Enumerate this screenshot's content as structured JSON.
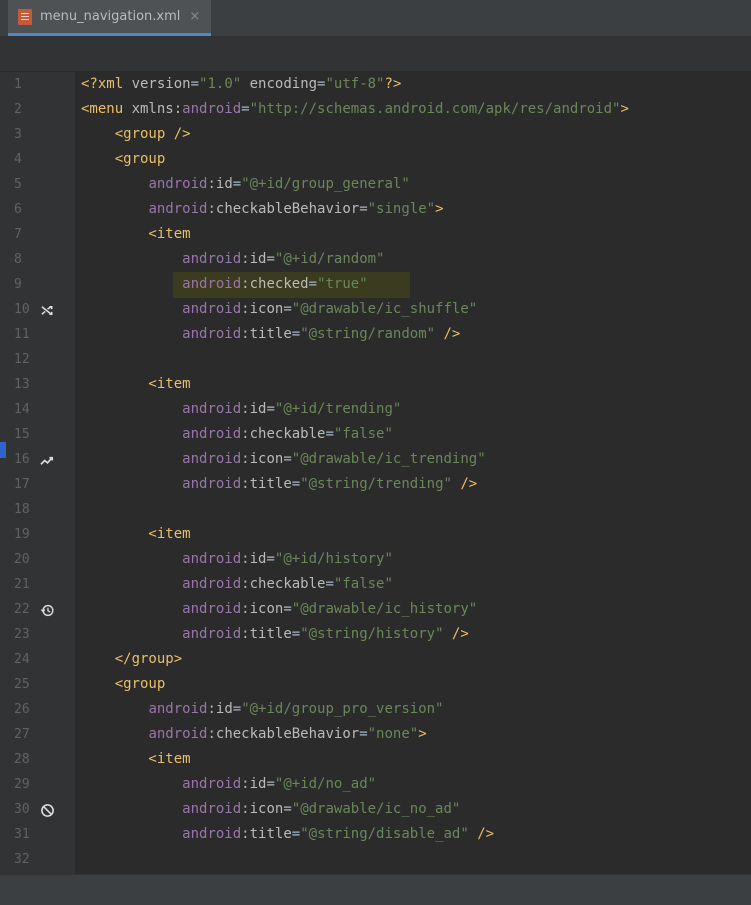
{
  "tab": {
    "filename": "menu_navigation.xml",
    "close_glyph": "×",
    "file_icon": "xml-file-icon"
  },
  "gutter": {
    "line_numbers": [
      "1",
      "2",
      "3",
      "4",
      "5",
      "6",
      "7",
      "8",
      "9",
      "10",
      "11",
      "12",
      "13",
      "14",
      "15",
      "16",
      "17",
      "18",
      "19",
      "20",
      "21",
      "22",
      "23",
      "24",
      "25",
      "26",
      "27",
      "28",
      "29",
      "30",
      "31",
      "32"
    ],
    "icons": [
      {
        "line": 10,
        "icon": "shuffle-icon"
      },
      {
        "line": 16,
        "icon": "trending-icon"
      },
      {
        "line": 22,
        "icon": "history-icon"
      },
      {
        "line": 30,
        "icon": "no-ad-icon"
      }
    ]
  },
  "highlight_line": 9,
  "colors": {
    "tag": "#e8bf6a",
    "namespace": "#9876aa",
    "attribute": "#bababa",
    "value": "#6a8759",
    "plain": "#a9b7c6",
    "line_number": "#606366",
    "highlight": "#3b3b20",
    "tab_underline": "#4a88c7"
  },
  "code": [
    [
      [
        "t",
        "<?xml "
      ],
      [
        "a",
        "version"
      ],
      [
        "p",
        "="
      ],
      [
        "v",
        "\"1.0\""
      ],
      [
        "a",
        " encoding"
      ],
      [
        "p",
        "="
      ],
      [
        "v",
        "\"utf-8\""
      ],
      [
        "t",
        "?>"
      ]
    ],
    [
      [
        "t",
        "<menu "
      ],
      [
        "a",
        "xmlns:"
      ],
      [
        "n",
        "android"
      ],
      [
        "p",
        "="
      ],
      [
        "v",
        "\"http://schemas.android.com/apk/res/android\""
      ],
      [
        "t",
        ">"
      ]
    ],
    [
      [
        "t",
        "    <group />"
      ]
    ],
    [
      [
        "t",
        "    <group"
      ]
    ],
    [
      [
        "p",
        "        "
      ],
      [
        "n",
        "android"
      ],
      [
        "p",
        ":"
      ],
      [
        "a",
        "id"
      ],
      [
        "p",
        "="
      ],
      [
        "v",
        "\"@+id/group_general\""
      ]
    ],
    [
      [
        "p",
        "        "
      ],
      [
        "n",
        "android"
      ],
      [
        "p",
        ":"
      ],
      [
        "a",
        "checkableBehavior"
      ],
      [
        "p",
        "="
      ],
      [
        "v",
        "\"single\""
      ],
      [
        "t",
        ">"
      ]
    ],
    [
      [
        "t",
        "        <item"
      ]
    ],
    [
      [
        "p",
        "            "
      ],
      [
        "n",
        "android"
      ],
      [
        "p",
        ":"
      ],
      [
        "a",
        "id"
      ],
      [
        "p",
        "="
      ],
      [
        "v",
        "\"@+id/random\""
      ]
    ],
    [
      [
        "p",
        "            "
      ],
      [
        "n",
        "android"
      ],
      [
        "p",
        ":"
      ],
      [
        "a",
        "checked"
      ],
      [
        "p",
        "="
      ],
      [
        "v",
        "\"true\""
      ]
    ],
    [
      [
        "p",
        "            "
      ],
      [
        "n",
        "android"
      ],
      [
        "p",
        ":"
      ],
      [
        "a",
        "icon"
      ],
      [
        "p",
        "="
      ],
      [
        "v",
        "\"@drawable/ic_shuffle\""
      ]
    ],
    [
      [
        "p",
        "            "
      ],
      [
        "n",
        "android"
      ],
      [
        "p",
        ":"
      ],
      [
        "a",
        "title"
      ],
      [
        "p",
        "="
      ],
      [
        "v",
        "\"@string/random\""
      ],
      [
        "t",
        " />"
      ]
    ],
    [],
    [
      [
        "t",
        "        <item"
      ]
    ],
    [
      [
        "p",
        "            "
      ],
      [
        "n",
        "android"
      ],
      [
        "p",
        ":"
      ],
      [
        "a",
        "id"
      ],
      [
        "p",
        "="
      ],
      [
        "v",
        "\"@+id/trending\""
      ]
    ],
    [
      [
        "p",
        "            "
      ],
      [
        "n",
        "android"
      ],
      [
        "p",
        ":"
      ],
      [
        "a",
        "checkable"
      ],
      [
        "p",
        "="
      ],
      [
        "v",
        "\"false\""
      ]
    ],
    [
      [
        "p",
        "            "
      ],
      [
        "n",
        "android"
      ],
      [
        "p",
        ":"
      ],
      [
        "a",
        "icon"
      ],
      [
        "p",
        "="
      ],
      [
        "v",
        "\"@drawable/ic_trending\""
      ]
    ],
    [
      [
        "p",
        "            "
      ],
      [
        "n",
        "android"
      ],
      [
        "p",
        ":"
      ],
      [
        "a",
        "title"
      ],
      [
        "p",
        "="
      ],
      [
        "v",
        "\"@string/trending\""
      ],
      [
        "t",
        " />"
      ]
    ],
    [],
    [
      [
        "t",
        "        <item"
      ]
    ],
    [
      [
        "p",
        "            "
      ],
      [
        "n",
        "android"
      ],
      [
        "p",
        ":"
      ],
      [
        "a",
        "id"
      ],
      [
        "p",
        "="
      ],
      [
        "v",
        "\"@+id/history\""
      ]
    ],
    [
      [
        "p",
        "            "
      ],
      [
        "n",
        "android"
      ],
      [
        "p",
        ":"
      ],
      [
        "a",
        "checkable"
      ],
      [
        "p",
        "="
      ],
      [
        "v",
        "\"false\""
      ]
    ],
    [
      [
        "p",
        "            "
      ],
      [
        "n",
        "android"
      ],
      [
        "p",
        ":"
      ],
      [
        "a",
        "icon"
      ],
      [
        "p",
        "="
      ],
      [
        "v",
        "\"@drawable/ic_history\""
      ]
    ],
    [
      [
        "p",
        "            "
      ],
      [
        "n",
        "android"
      ],
      [
        "p",
        ":"
      ],
      [
        "a",
        "title"
      ],
      [
        "p",
        "="
      ],
      [
        "v",
        "\"@string/history\""
      ],
      [
        "t",
        " />"
      ]
    ],
    [
      [
        "t",
        "    </group>"
      ]
    ],
    [
      [
        "t",
        "    <group"
      ]
    ],
    [
      [
        "p",
        "        "
      ],
      [
        "n",
        "android"
      ],
      [
        "p",
        ":"
      ],
      [
        "a",
        "id"
      ],
      [
        "p",
        "="
      ],
      [
        "v",
        "\"@+id/group_pro_version\""
      ]
    ],
    [
      [
        "p",
        "        "
      ],
      [
        "n",
        "android"
      ],
      [
        "p",
        ":"
      ],
      [
        "a",
        "checkableBehavior"
      ],
      [
        "p",
        "="
      ],
      [
        "v",
        "\"none\""
      ],
      [
        "t",
        ">"
      ]
    ],
    [
      [
        "t",
        "        <item"
      ]
    ],
    [
      [
        "p",
        "            "
      ],
      [
        "n",
        "android"
      ],
      [
        "p",
        ":"
      ],
      [
        "a",
        "id"
      ],
      [
        "p",
        "="
      ],
      [
        "v",
        "\"@+id/no_ad\""
      ]
    ],
    [
      [
        "p",
        "            "
      ],
      [
        "n",
        "android"
      ],
      [
        "p",
        ":"
      ],
      [
        "a",
        "icon"
      ],
      [
        "p",
        "="
      ],
      [
        "v",
        "\"@drawable/ic_no_ad\""
      ]
    ],
    [
      [
        "p",
        "            "
      ],
      [
        "n",
        "android"
      ],
      [
        "p",
        ":"
      ],
      [
        "a",
        "title"
      ],
      [
        "p",
        "="
      ],
      [
        "v",
        "\"@string/disable_ad\""
      ],
      [
        "t",
        " />"
      ]
    ],
    []
  ]
}
